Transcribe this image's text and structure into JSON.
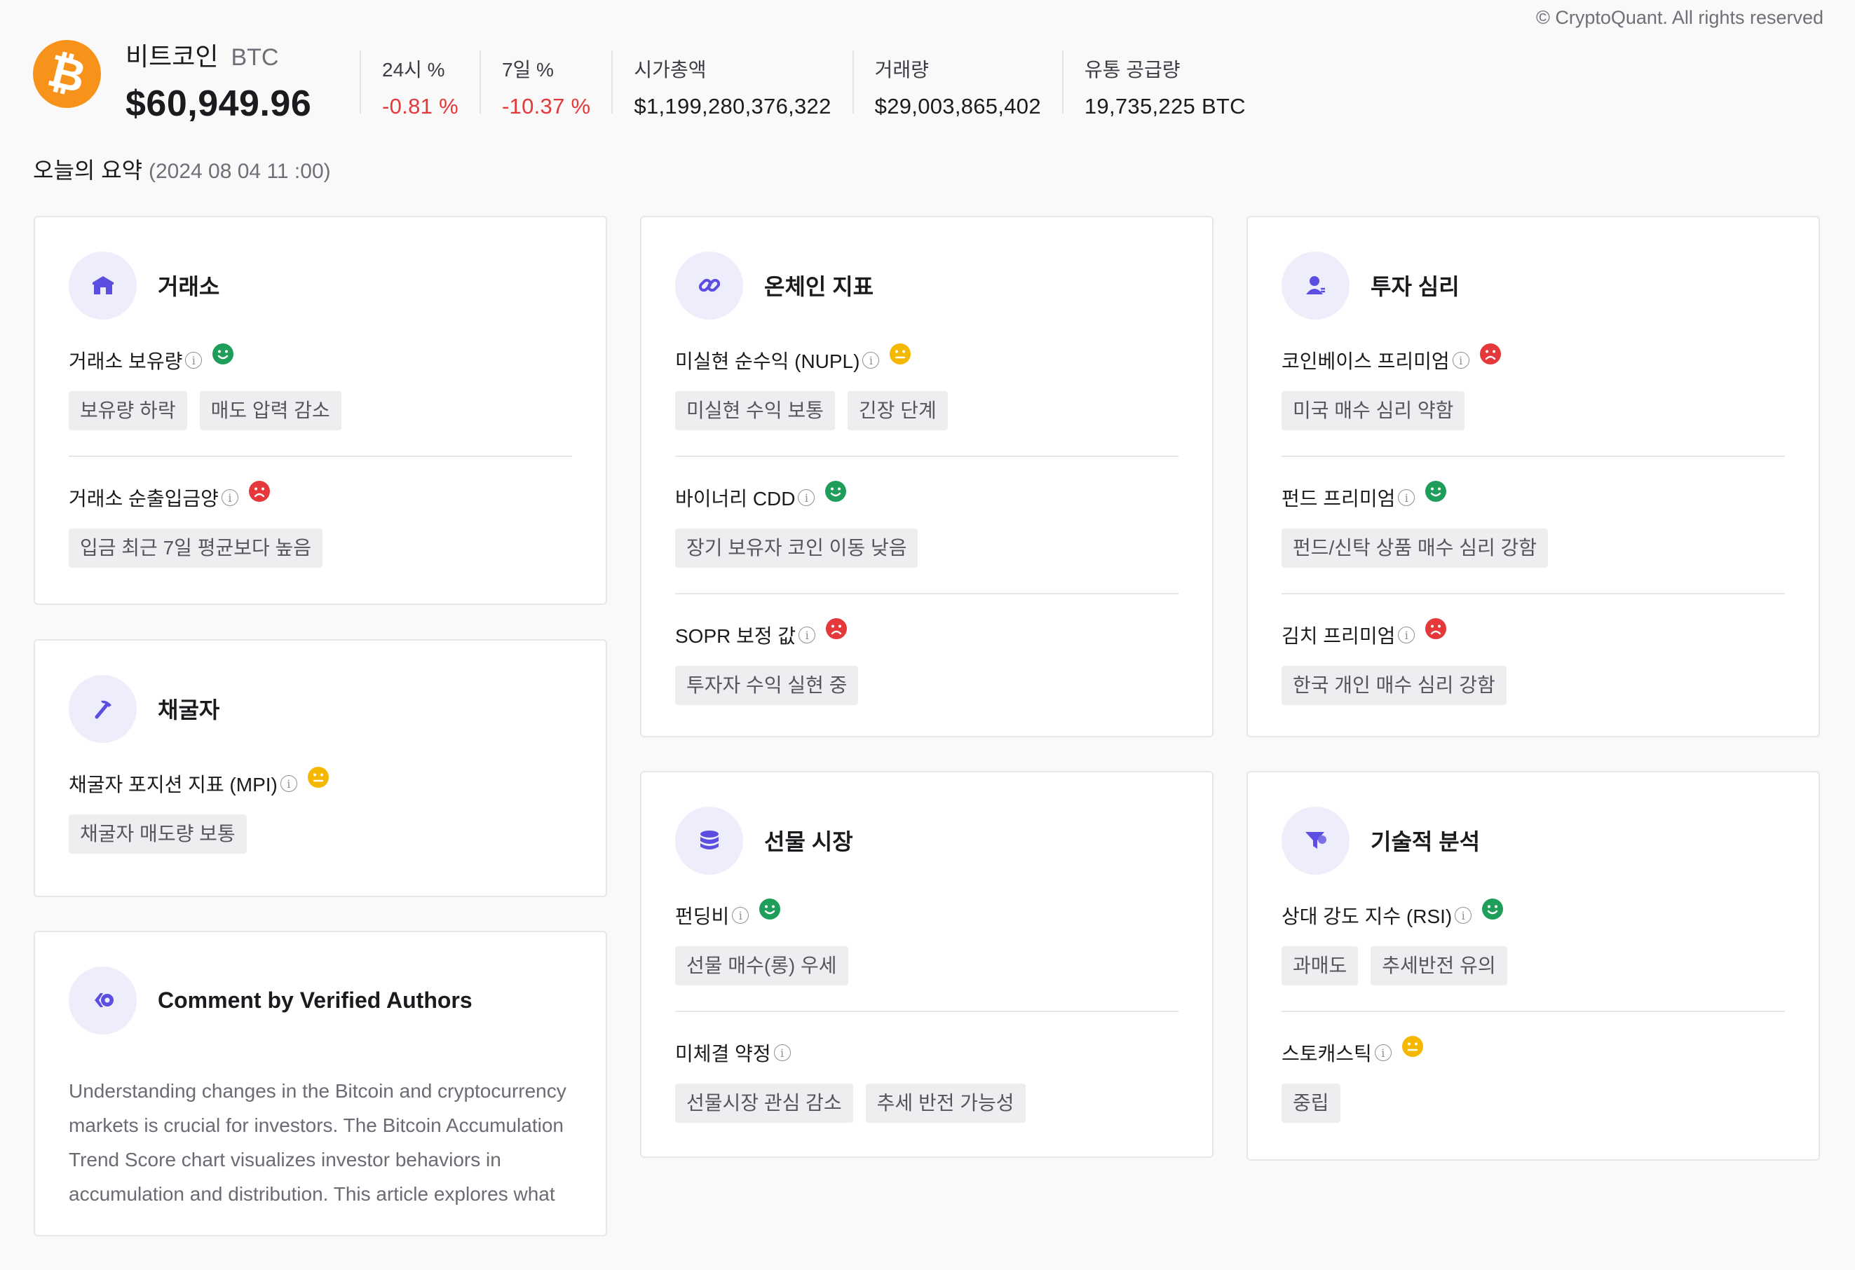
{
  "copyright": "© CryptoQuant. All rights reserved",
  "coin": {
    "name": "비트코인",
    "symbol": "BTC",
    "price": "$60,949.96",
    "logo_glyph": "₿",
    "logo_color": "#f7931a"
  },
  "stats": [
    {
      "label": "24시 %",
      "value": "-0.81 %",
      "negative": true
    },
    {
      "label": "7일 %",
      "value": "-10.37 %",
      "negative": true
    },
    {
      "label": "시가총액",
      "value": "$1,199,280,376,322",
      "negative": false
    },
    {
      "label": "거래량",
      "value": "$29,003,865,402",
      "negative": false
    },
    {
      "label": "유통 공급량",
      "value": "19,735,225  BTC",
      "negative": false
    }
  ],
  "summary": {
    "title": "오늘의 요약",
    "date": "(2024 08 04 11 :00)"
  },
  "colors": {
    "positive": "#1e9e5a",
    "neutral": "#f5b800",
    "negative": "#e5383b",
    "accent": "#5b4ee0"
  },
  "cards": {
    "exchange": {
      "title": "거래소",
      "icon": "bank-icon",
      "metrics": [
        {
          "name": "거래소 보유량",
          "sentiment": "positive",
          "tags": [
            "보유량 하락",
            "매도 압력 감소"
          ]
        },
        {
          "name": "거래소 순출입금양",
          "sentiment": "negative",
          "tags": [
            "입금 최근 7일 평균보다 높음"
          ]
        }
      ]
    },
    "miner": {
      "title": "채굴자",
      "icon": "pickaxe-icon",
      "metrics": [
        {
          "name": "채굴자 포지션 지표 (MPI)",
          "sentiment": "neutral",
          "tags": [
            "채굴자 매도량 보통"
          ]
        }
      ]
    },
    "comment": {
      "title": "Comment by Verified Authors",
      "icon": "quote-icon",
      "text": "Understanding changes in the Bitcoin and cryptocurrency markets is crucial for investors. The Bitcoin Accumulation Trend Score chart visualizes investor behaviors in accumulation and distribution. This article explores what"
    },
    "onchain": {
      "title": "온체인 지표",
      "icon": "link-icon",
      "metrics": [
        {
          "name": "미실현 순수익 (NUPL)",
          "sentiment": "neutral",
          "tags": [
            "미실현 수익 보통",
            "긴장 단계"
          ]
        },
        {
          "name": "바이너리 CDD",
          "sentiment": "positive",
          "tags": [
            "장기 보유자 코인 이동 낮음"
          ]
        },
        {
          "name": "SOPR 보정 값",
          "sentiment": "negative",
          "tags": [
            "투자자 수익 실현 중"
          ]
        }
      ]
    },
    "futures": {
      "title": "선물 시장",
      "icon": "database-icon",
      "metrics": [
        {
          "name": "펀딩비",
          "sentiment": "positive",
          "tags": [
            "선물 매수(롱) 우세"
          ]
        },
        {
          "name": "미체결 약정",
          "sentiment": "none",
          "tags": [
            "선물시장 관심 감소",
            "추세 반전 가능성"
          ]
        }
      ]
    },
    "sentiment": {
      "title": "투자 심리",
      "icon": "user-icon",
      "metrics": [
        {
          "name": "코인베이스 프리미엄",
          "sentiment": "negative",
          "tags": [
            "미국 매수 심리 약함"
          ]
        },
        {
          "name": "펀드 프리미엄",
          "sentiment": "positive",
          "tags": [
            "펀드/신탁 상품 매수 심리 강함"
          ]
        },
        {
          "name": "김치 프리미엄",
          "sentiment": "negative",
          "tags": [
            "한국 개인 매수 심리 강함"
          ]
        }
      ]
    },
    "technical": {
      "title": "기술적 분석",
      "icon": "funnel-icon",
      "metrics": [
        {
          "name": "상대 강도 지수 (RSI)",
          "sentiment": "positive",
          "tags": [
            "과매도",
            "추세반전 유의"
          ]
        },
        {
          "name": "스토캐스틱",
          "sentiment": "neutral",
          "tags": [
            "중립"
          ]
        }
      ]
    }
  }
}
